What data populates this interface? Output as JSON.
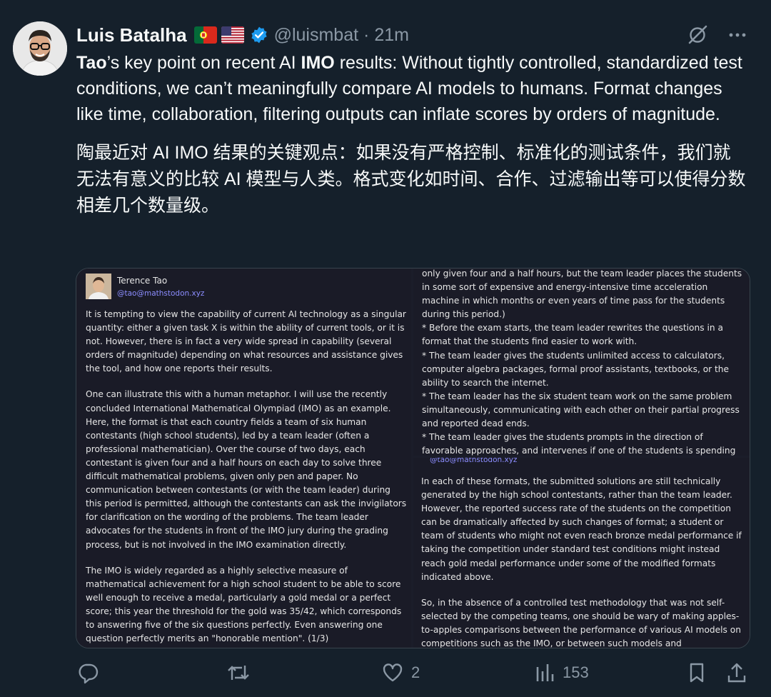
{
  "author": {
    "name": "Luis Batalha",
    "handle": "@luismbat",
    "separator": "·",
    "time": "21m",
    "flags": [
      "portugal-flag-icon",
      "usa-flag-icon"
    ],
    "verified_color": "#1d9bf0"
  },
  "tweet": {
    "en_part1": "Tao",
    "en_part2": "’s key point on recent AI ",
    "en_part3": "IMO",
    "en_part4": " results: Without tightly controlled, standardized test conditions, we can’t meaningfully compare AI models to humans. Format changes like time, collaboration, filtering outputs can inflate scores by orders of magnitude.",
    "zh": "陶最近对 AI IMO 结果的关键观点：如果没有严格控制、标准化的测试条件，我们就无法有意义的比较 AI 模型与人类。格式变化如时间、合作、过滤输出等可以使得分数相差几个数量级。"
  },
  "media": {
    "left": {
      "author_name": "Terence Tao",
      "author_handle": "@tao@mathstodon.xyz",
      "paragraphs": [
        "It is tempting to view the capability of current AI technology as a singular quantity: either a given task X is within the ability of current tools, or it is not.  However, there is in fact a very wide spread in capability (several orders of magnitude) depending on what resources and assistance gives the tool, and how one reports their results.",
        "One can illustrate this with a human metaphor.  I will use the recently concluded International Mathematical Olympiad (IMO) as an example. Here, the format is that each country fields a team of six human contestants (high school students), led by a team leader (often a professional mathematician).  Over the course of two days, each contestant is given four and a half hours on each day to solve three difficult mathematical problems, given only pen and paper. No communication between contestants (or with the team leader) during this period is permitted, although the contestants can ask the invigilators for clarification on the wording of the problems.  The team leader advocates for the students in front of the IMO jury during the grading process, but is not involved in the IMO examination directly.",
        "The IMO is widely regarded as a highly selective measure of mathematical achievement for a high school student to be able to score well enough to receive a medal, particularly a gold medal or a perfect score; this year the threshold for the gold was 35/42, which corresponds to answering five of the six questions perfectly.  Even answering one question perfectly merits an \"honorable mention\". (1/3)"
      ]
    },
    "right_top": {
      "lines": [
        "only given four and a half hours, but the team leader places the students in some sort of expensive and energy-intensive time acceleration machine in which months or even years of time pass for the students during this period.)",
        "* Before the exam starts, the team leader rewrites the questions in a format that the students find easier to work with.",
        "* The team leader gives the students unlimited access to calculators, computer algebra packages, formal proof assistants, textbooks, or the ability to search the internet.",
        "* The team leader has the six student team work on the same problem simultaneously,  communicating with each other on their partial progress and reported dead ends.",
        "* The team leader gives the students prompts in the direction of favorable approaches, and intervenes if one of the students is spending"
      ]
    },
    "right_bottom": {
      "cut_handle": "@tao@mathstodon.xyz",
      "paragraphs": [
        "In each of these formats, the submitted solutions are still technically generated by the high school contestants, rather than the team leader. However, the reported success rate of the students on the competition can be dramatically affected by such changes of format; a student or team of students who might not even reach bronze medal performance if taking the competition under standard test conditions might instead reach gold medal performance under some of the modified formats indicated above.",
        "So, in the absence of a controlled test methodology that was not self-selected by the competing teams, one should be wary of making apples-to-apples comparisons between the performance of various AI models on competitions such as the IMO, or between such models and"
      ]
    }
  },
  "actions": {
    "reply_count": "",
    "retweet_count": "",
    "like_count": "2",
    "views_count": "153"
  }
}
